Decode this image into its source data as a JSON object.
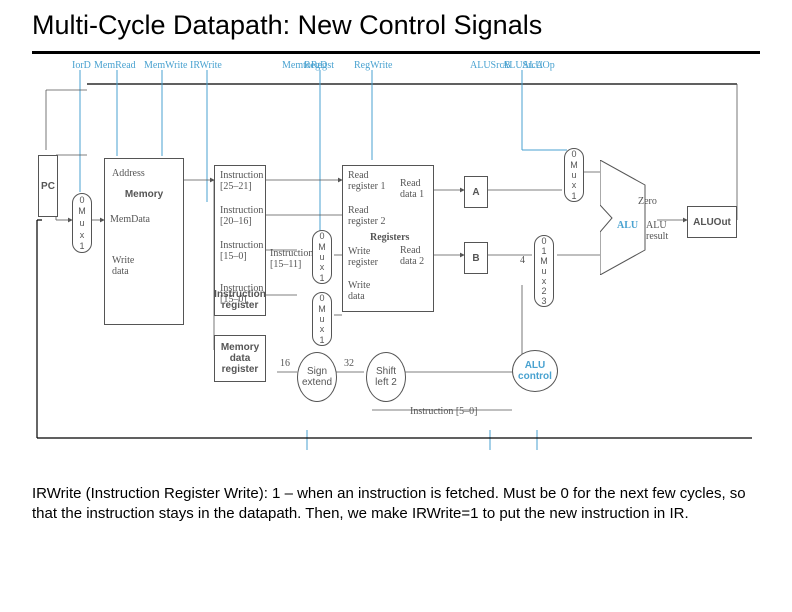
{
  "title": "Multi-Cycle Datapath: New Control Signals",
  "signals": {
    "iord": "IorD",
    "memread": "MemRead",
    "memwrite": "MemWrite",
    "irwrite": "IRWrite",
    "regdst": "RegDst",
    "regwrite": "RegWrite",
    "alusrca": "ALUSrcA",
    "memtoreg": "MemtoReg",
    "alusrcb": "ALUSrcB",
    "aluop": "ALUOp"
  },
  "blocks": {
    "pc": "PC",
    "memory": "Memory",
    "address": "Address",
    "memdata": "MemData",
    "writedata": "Write\ndata",
    "ir": "Instruction\nregister",
    "mdr": "Memory\ndata\nregister",
    "registers": "Registers",
    "readreg1": "Read\nregister 1",
    "readreg2": "Read\nregister 2",
    "writereg": "Write\nregister",
    "writedata2": "Write\ndata",
    "readdata1": "Read\ndata 1",
    "readdata2": "Read\ndata 2",
    "signext": "Sign\nextend",
    "shiftleft": "Shift\nleft 2",
    "alu": "ALU",
    "alures": "ALU\nresult",
    "aluout": "ALUOut",
    "aluctrl": "ALU\ncontrol",
    "a": "A",
    "b": "B",
    "zero": "Zero"
  },
  "instr": {
    "i2521": "Instruction\n[25–21]",
    "i2016": "Instruction\n[20–16]",
    "i150": "Instruction\n[15–0]",
    "i1511": "Instruction\n[15–11]",
    "i150b": "Instruction\n[15–0]",
    "i50": "Instruction  [5–0]"
  },
  "nums": {
    "n16": "16",
    "n32": "32",
    "n4": "4"
  },
  "mux": {
    "m": "M",
    "u": "u",
    "x": "x"
  },
  "description": "IRWrite (Instruction Register Write): 1 – when an instruction is fetched. Must be 0 for the next few cycles, so that the instruction stays in the datapath. Then, we make IRWrite=1 to put the new instruction in IR."
}
